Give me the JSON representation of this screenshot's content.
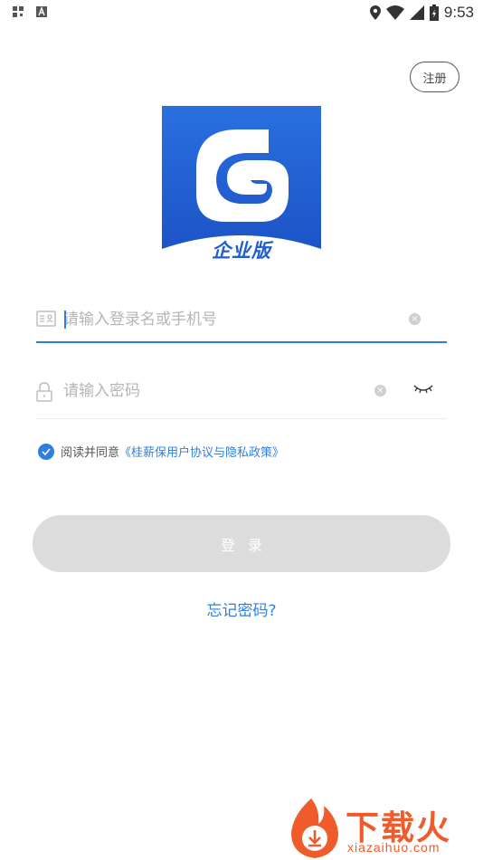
{
  "status_bar": {
    "time": "9:53"
  },
  "header": {
    "register_label": "注册"
  },
  "logo": {
    "label": "企业版"
  },
  "login_form": {
    "username_placeholder": "请输入登录名或手机号",
    "password_placeholder": "请输入密码"
  },
  "agreement": {
    "text": "阅读并同意",
    "link": "《桂薪保用户协议与隐私政策》",
    "checked": true
  },
  "actions": {
    "login_label": "登录",
    "forgot_label": "忘记密码?"
  },
  "watermark": {
    "title": "下载火",
    "domain": "xiazaihuo.com"
  },
  "colors": {
    "accent": "#2f7fe0",
    "logo_blue": "#1f5fd1",
    "button_disabled": "#dcdcdc",
    "watermark": "#ef5b2a"
  }
}
